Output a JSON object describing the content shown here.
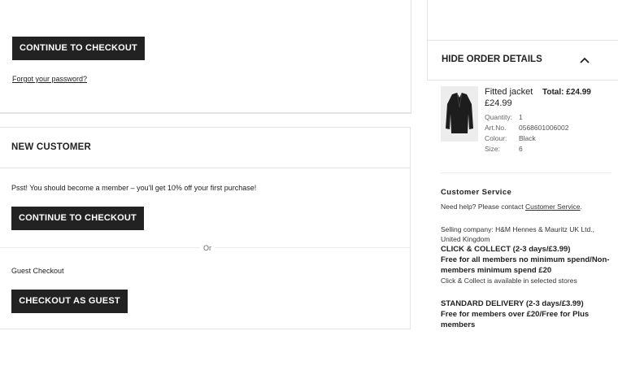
{
  "login": {
    "continue_label": "CONTINUE TO CHECKOUT",
    "forgot_label": "Forgot your password?"
  },
  "new_customer": {
    "title": "NEW CUSTOMER",
    "promo": "Psst! You should become a member – you'll get 10% off your first purchase!",
    "continue_label": "CONTINUE TO CHECKOUT",
    "or_label": "Or",
    "guest_label": "Guest Checkout",
    "guest_button_label": "CHECKOUT AS GUEST"
  },
  "order_details": {
    "toggle_label": "HIDE ORDER DETAILS",
    "chevron_icon": "chevron-up-icon",
    "product": {
      "name": "Fitted jacket",
      "total": "Total: £24.99",
      "price": "£24.99",
      "image_icon": "jacket-image",
      "attrs": [
        {
          "label": "Quantity:",
          "value": "1"
        },
        {
          "label": "Art.No.",
          "value": "0568601006002"
        },
        {
          "label": "Colour:",
          "value": "Black"
        },
        {
          "label": "Size:",
          "value": "6"
        }
      ]
    }
  },
  "customer_service": {
    "title": "Customer Service",
    "help_prefix": "Need help? Please contact ",
    "help_link": "Customer Service",
    "help_suffix": ".",
    "selling_company": "Selling company: H&M Hennes & Mauritz UK Ltd., United Kingdom",
    "click_collect_title": "CLICK & COLLECT (2-3 days/£3.99)",
    "click_collect_desc": "Free for all members no minimum spend/Non-members minimum spend £20",
    "click_collect_note": "Click & Collect is available in selected stores",
    "standard_title": "STANDARD DELIVERY (2-3 days/£3.99)",
    "standard_desc": "Free for members over £20/Free for Plus members"
  },
  "colors": {
    "button_bg": "#222222",
    "border": "#e4e4e4"
  }
}
